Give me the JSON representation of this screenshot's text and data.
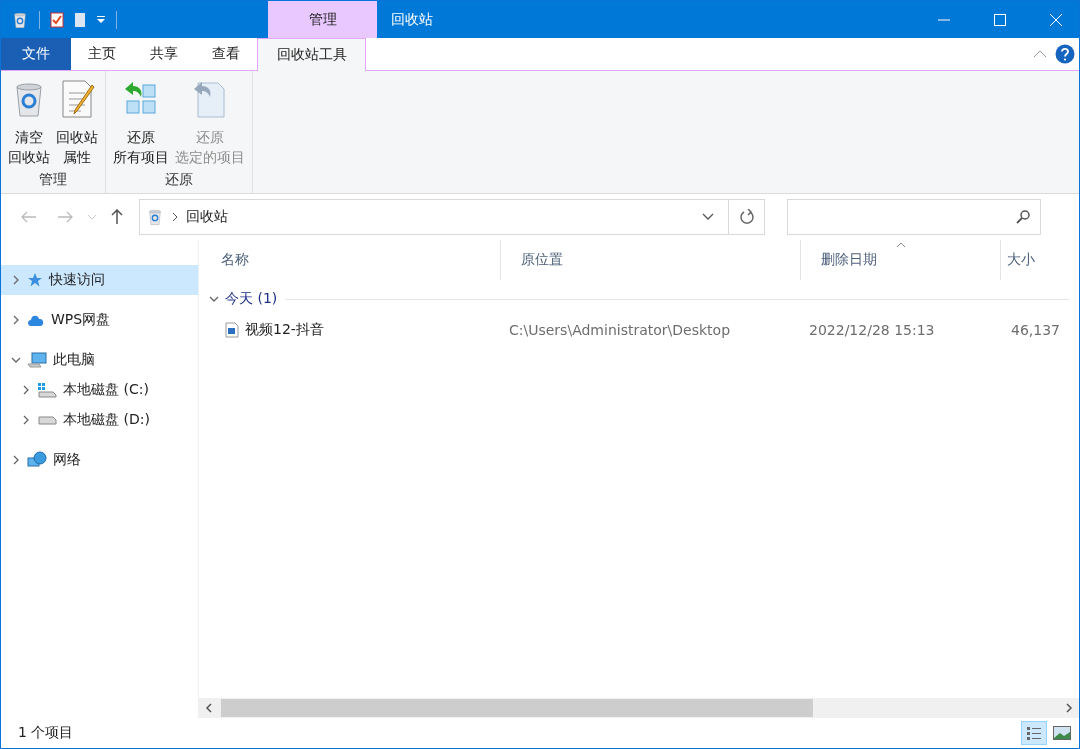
{
  "title_bar": {
    "context_group": "管理",
    "title": "回收站"
  },
  "ribbon_tabs": [
    {
      "label": "文件",
      "kind": "file",
      "selected": false
    },
    {
      "label": "主页",
      "kind": "normal",
      "selected": false
    },
    {
      "label": "共享",
      "kind": "normal",
      "selected": false
    },
    {
      "label": "查看",
      "kind": "normal",
      "selected": false
    },
    {
      "label": "回收站工具",
      "kind": "context",
      "selected": true
    }
  ],
  "ribbon_groups": [
    {
      "label": "管理",
      "buttons": [
        {
          "lines": [
            "清空",
            "回收站"
          ],
          "disabled": false
        },
        {
          "lines": [
            "回收站",
            "属性"
          ],
          "disabled": false
        }
      ]
    },
    {
      "label": "还原",
      "buttons": [
        {
          "lines": [
            "还原",
            "所有项目"
          ],
          "disabled": false
        },
        {
          "lines": [
            "还原",
            "选定的项目"
          ],
          "disabled": true
        }
      ]
    }
  ],
  "address": {
    "crumb": "回收站"
  },
  "sidebar": [
    {
      "label": "快速访问",
      "expanded": false,
      "selected": true
    },
    {
      "label": "WPS网盘",
      "expanded": false,
      "selected": false
    },
    {
      "label": "此电脑",
      "expanded": true,
      "selected": false,
      "children": [
        {
          "label": "本地磁盘 (C:)",
          "expanded": false,
          "selected": false
        },
        {
          "label": "本地磁盘 (D:)",
          "expanded": false,
          "selected": false
        }
      ]
    },
    {
      "label": "网络",
      "expanded": false,
      "selected": false
    }
  ],
  "columns": [
    {
      "label": "名称",
      "sorted": false
    },
    {
      "label": "原位置",
      "sorted": false
    },
    {
      "label": "删除日期",
      "sorted": true
    },
    {
      "label": "大小",
      "sorted": false
    }
  ],
  "groups": [
    {
      "label": "今天 (1)",
      "expanded": true,
      "rows": [
        {
          "name": "视频12-抖音",
          "location": "C:\\Users\\Administrator\\Desktop",
          "deleted": "2022/12/28 15:13",
          "size": "46,137"
        }
      ]
    }
  ],
  "status_bar": {
    "count": "1 个项目",
    "views": [
      {
        "kind": "details",
        "selected": true
      },
      {
        "kind": "tiles",
        "selected": false
      }
    ]
  }
}
